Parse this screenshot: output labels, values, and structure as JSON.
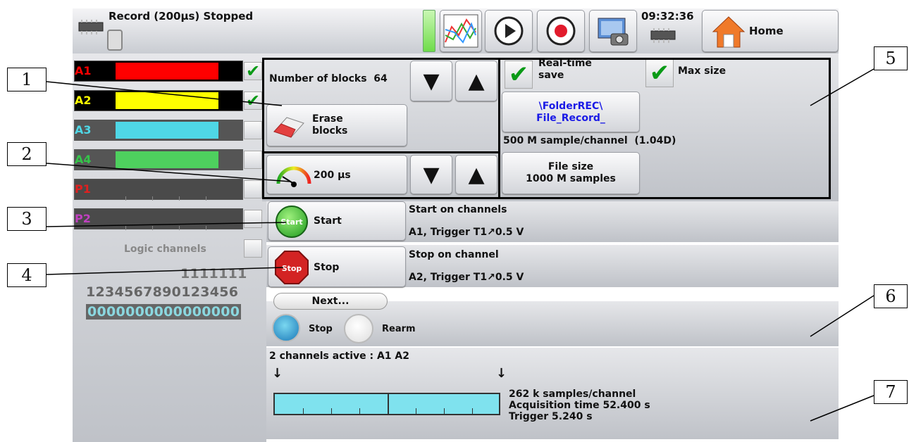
{
  "topbar": {
    "title": "Record (200µs) Stopped",
    "clock": "09:32:36",
    "home_label": "Home"
  },
  "channels": [
    {
      "label": "A1",
      "label_color": "#ff0000",
      "bar_color": "#ff0000",
      "checked": true
    },
    {
      "label": "A2",
      "label_color": "#ffff00",
      "bar_color": "#ffff00",
      "checked": true
    },
    {
      "label": "A3",
      "label_color": "#4fd7e6",
      "bar_color": "#4fd7e6",
      "checked": false
    },
    {
      "label": "A4",
      "label_color": "#35c44a",
      "bar_color": "#4ed05e",
      "checked": false
    },
    {
      "label": "P1",
      "label_color": "#e02020",
      "bar_color": "",
      "checked": false
    },
    {
      "label": "P2",
      "label_color": "#c040c0",
      "bar_color": "",
      "checked": false
    }
  ],
  "logic": {
    "title": "Logic channels",
    "row1": "1111111",
    "row2": "1234567890123456",
    "row3": "0000000000000000"
  },
  "blocks": {
    "label": "Number of blocks",
    "value": "64",
    "erase_line1": "Erase",
    "erase_line2": "blocks"
  },
  "sampling": {
    "value": "200 µs"
  },
  "save": {
    "realtime_line1": "Real-time",
    "realtime_line2": "save",
    "maxsize": "Max size",
    "folder_line1": "\\FolderREC\\",
    "folder_line2": "File_Record_",
    "info": "500 M sample/channel  (1.04D)",
    "filesize_line1": "File size",
    "filesize_line2": "1000 M samples"
  },
  "start": {
    "button": "Start",
    "icon_text": "Start",
    "heading": "Start on channels",
    "detail": "A1, Trigger T1↗0.5 V"
  },
  "stop": {
    "button": "Stop",
    "icon_text": "Stop",
    "heading": "Stop on channel",
    "detail": "A2, Trigger T1↗0.5 V"
  },
  "next": {
    "label": "Next...",
    "opt_stop": "Stop",
    "opt_rearm": "Rearm",
    "selected": "Stop"
  },
  "summary": {
    "active": "2 channels active : A1 A2",
    "samples": "262 k samples/channel",
    "acq": "Acquisition time 52.400 s",
    "trigger": "Trigger  5.240 s"
  },
  "callouts": [
    "1",
    "2",
    "3",
    "4",
    "5",
    "6",
    "7"
  ],
  "colors": {
    "accent_blue": "#1a1ae6",
    "check_green": "#0a9a16",
    "timeline": "#7fe2ee"
  }
}
